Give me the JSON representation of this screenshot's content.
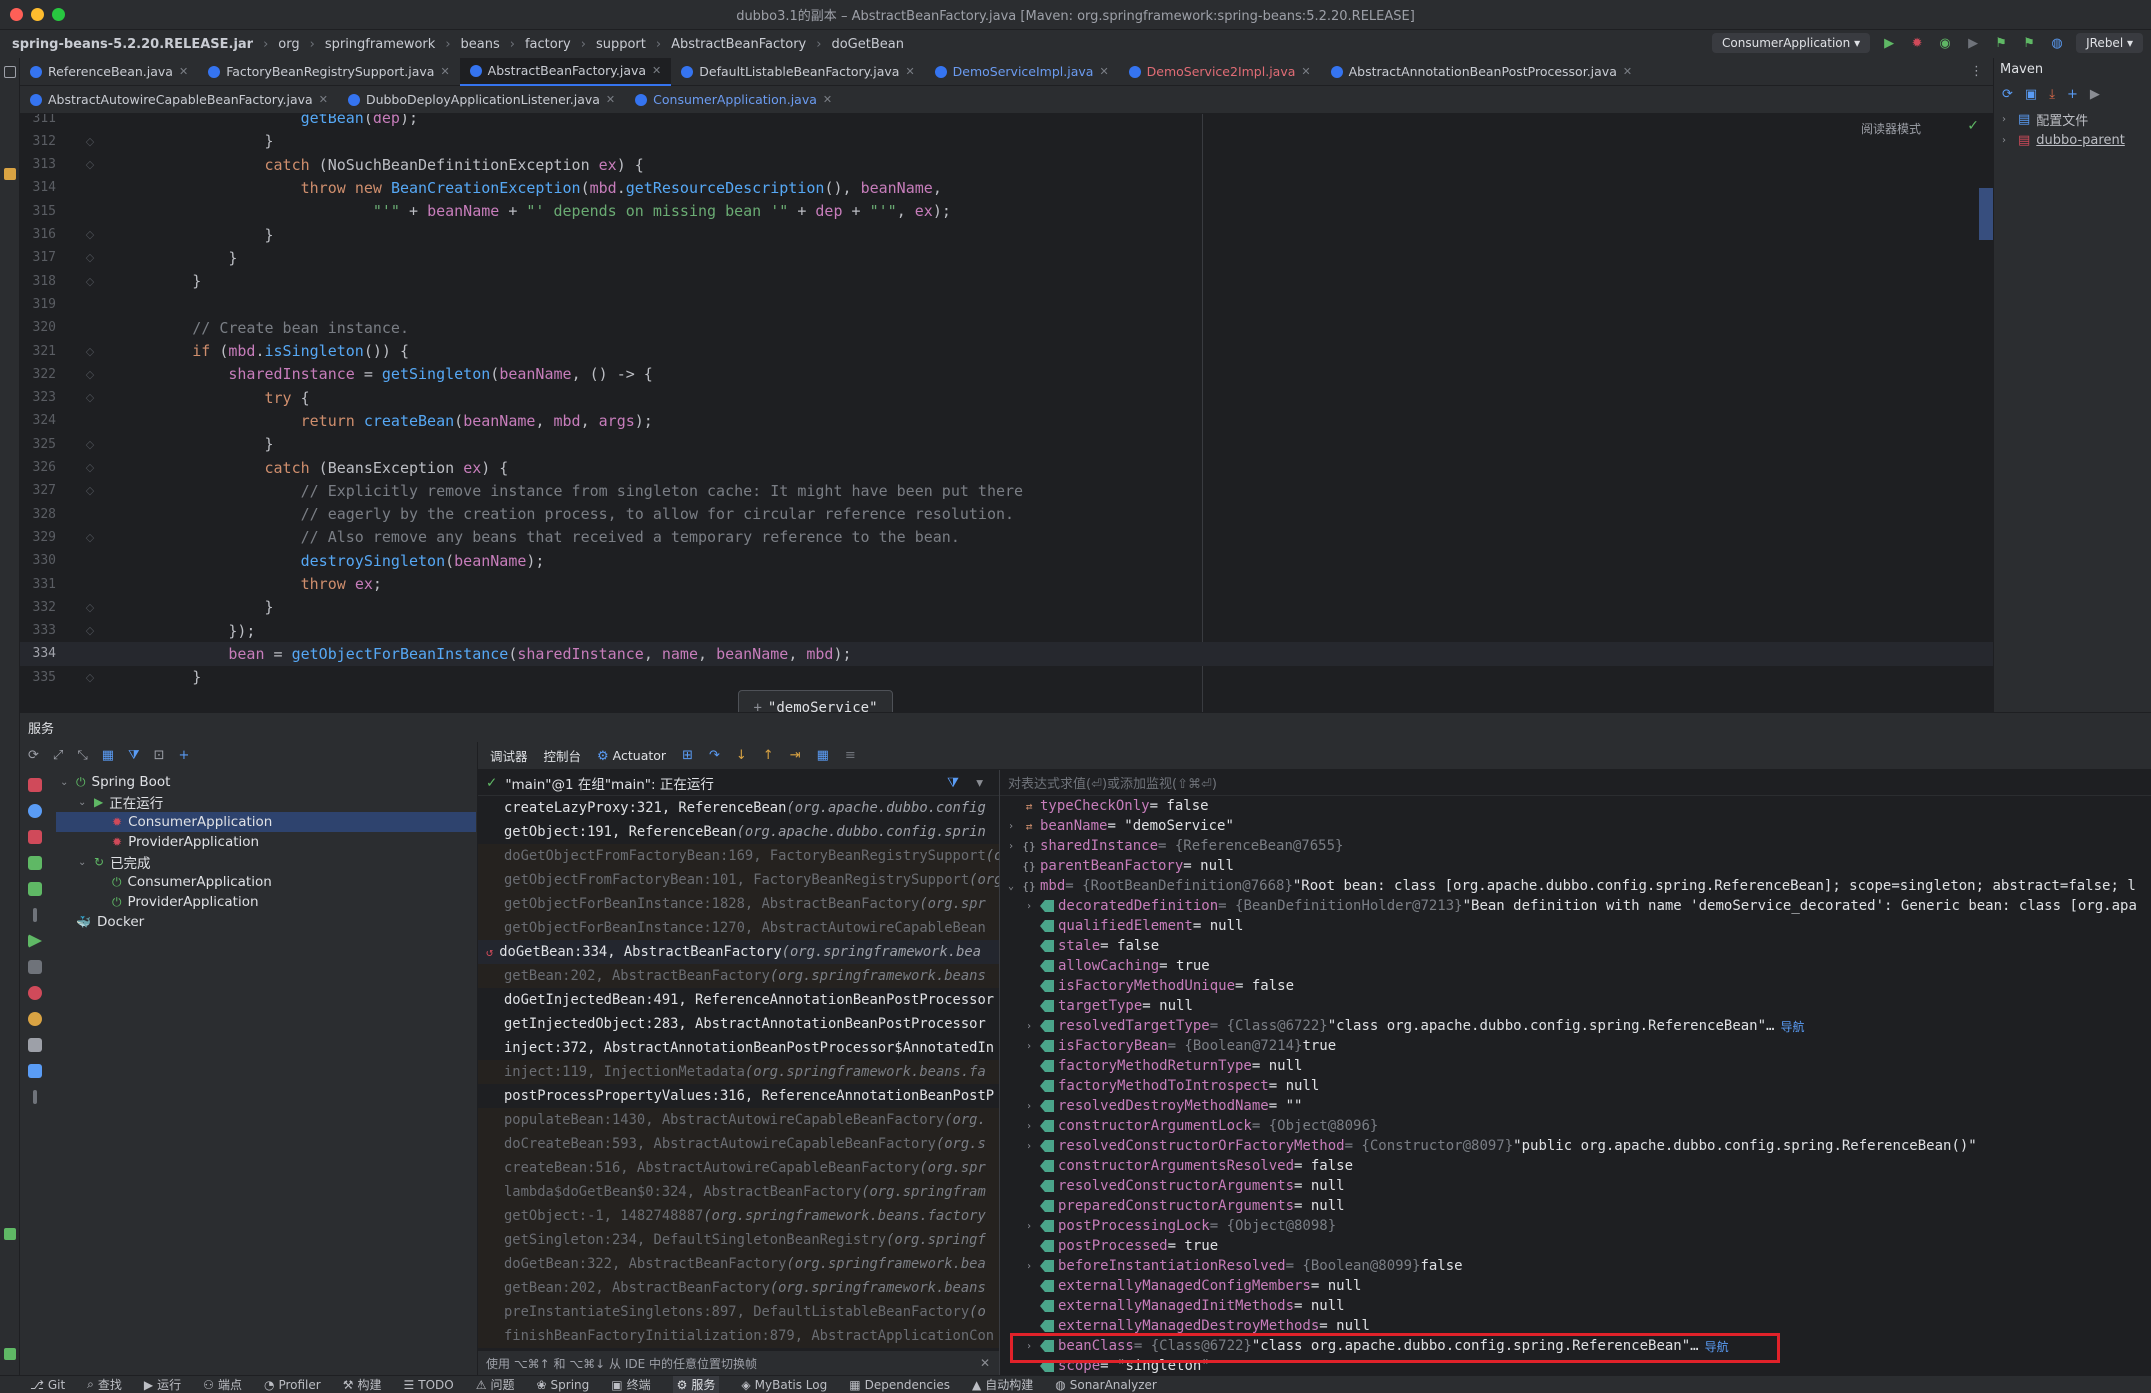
{
  "window": {
    "title": "dubbo3.1的副本 – AbstractBeanFactory.java [Maven: org.springframework:spring-beans:5.2.20.RELEASE]"
  },
  "breadcrumb": [
    "spring-beans-5.2.20.RELEASE.jar",
    "org",
    "springframework",
    "beans",
    "factory",
    "support",
    "AbstractBeanFactory",
    "doGetBean"
  ],
  "toolbar": {
    "run_config": "ConsumerApplication",
    "jrebel": "JRebel"
  },
  "tabs_row1": [
    {
      "label": "ReferenceBean.java",
      "style": "normal"
    },
    {
      "label": "FactoryBeanRegistrySupport.java",
      "style": "normal"
    },
    {
      "label": "AbstractBeanFactory.java",
      "style": "active"
    },
    {
      "label": "DefaultListableBeanFactory.java",
      "style": "normal"
    },
    {
      "label": "DemoServiceImpl.java",
      "style": "blue"
    },
    {
      "label": "DemoService2Impl.java",
      "style": "red"
    },
    {
      "label": "AbstractAnnotationBeanPostProcessor.java",
      "style": "normal"
    }
  ],
  "tabs_row2": [
    {
      "label": "AbstractAutowireCapableBeanFactory.java",
      "style": "normal"
    },
    {
      "label": "DubboDeployApplicationListener.java",
      "style": "normal"
    },
    {
      "label": "ConsumerApplication.java",
      "style": "blue"
    }
  ],
  "editor": {
    "reader_mode": "阅读器模式",
    "current_line": "334",
    "lines": [
      {
        "n": "311",
        "code": "                    getBean(dep);"
      },
      {
        "n": "312",
        "code": "                }"
      },
      {
        "n": "313",
        "code": "                catch (NoSuchBeanDefinitionException ex) {"
      },
      {
        "n": "314",
        "code": "                    throw new BeanCreationException(mbd.getResourceDescription(), beanName,"
      },
      {
        "n": "315",
        "code": "                            \"'\" + beanName + \"' depends on missing bean '\" + dep + \"'\", ex);"
      },
      {
        "n": "316",
        "code": "                }"
      },
      {
        "n": "317",
        "code": "            }"
      },
      {
        "n": "318",
        "code": "        }"
      },
      {
        "n": "319",
        "code": ""
      },
      {
        "n": "320",
        "code": "        // Create bean instance."
      },
      {
        "n": "321",
        "code": "        if (mbd.isSingleton()) {"
      },
      {
        "n": "322",
        "code": "            sharedInstance = getSingleton(beanName, () -> {"
      },
      {
        "n": "323",
        "code": "                try {"
      },
      {
        "n": "324",
        "code": "                    return createBean(beanName, mbd, args);"
      },
      {
        "n": "325",
        "code": "                }"
      },
      {
        "n": "326",
        "code": "                catch (BeansException ex) {"
      },
      {
        "n": "327",
        "code": "                    // Explicitly remove instance from singleton cache: It might have been put there"
      },
      {
        "n": "328",
        "code": "                    // eagerly by the creation process, to allow for circular reference resolution."
      },
      {
        "n": "329",
        "code": "                    // Also remove any beans that received a temporary reference to the bean."
      },
      {
        "n": "330",
        "code": "                    destroySingleton(beanName);"
      },
      {
        "n": "331",
        "code": "                    throw ex;"
      },
      {
        "n": "332",
        "code": "                }"
      },
      {
        "n": "333",
        "code": "            });"
      },
      {
        "n": "334",
        "code": "            bean = getObjectForBeanInstance(sharedInstance, name, beanName, mbd);"
      },
      {
        "n": "335",
        "code": "        }"
      }
    ],
    "tooltip": "\"demoService\""
  },
  "maven": {
    "title": "Maven",
    "items": [
      "配置文件",
      "dubbo-parent"
    ]
  },
  "services": {
    "title": "服务",
    "tree": [
      {
        "label": "Spring Boot",
        "level": 0,
        "arrow": "⌄"
      },
      {
        "label": "正在运行",
        "level": 1,
        "arrow": "⌄"
      },
      {
        "label": "ConsumerApplication",
        "level": 2,
        "arrow": "",
        "selected": true
      },
      {
        "label": "ProviderApplication",
        "level": 2,
        "arrow": ""
      },
      {
        "label": "已完成",
        "level": 1,
        "arrow": "⌄"
      },
      {
        "label": "ConsumerApplication",
        "level": 2,
        "arrow": ""
      },
      {
        "label": "ProviderApplication",
        "level": 2,
        "arrow": ""
      },
      {
        "label": "Docker",
        "level": 0,
        "arrow": ""
      }
    ]
  },
  "debugger": {
    "tabs": [
      "调试器",
      "控制台",
      "Actuator"
    ],
    "thread": "\"main\"@1 在组\"main\": 正在运行",
    "eval_placeholder": "对表达式求值(⏎)或添加监视(⇧⌘⏎)",
    "frames": [
      {
        "m": "createLazyProxy:321, ReferenceBean",
        "p": "(org.apache.dubbo.config",
        "kind": "usr"
      },
      {
        "m": "getObject:191, ReferenceBean",
        "p": "(org.apache.dubbo.config.sprin",
        "kind": "usr"
      },
      {
        "m": "doGetObjectFromFactoryBean:169, FactoryBeanRegistrySupport",
        "p": "(o",
        "kind": "lib"
      },
      {
        "m": "getObjectFromFactoryBean:101, FactoryBeanRegistrySupport",
        "p": "(org",
        "kind": "lib"
      },
      {
        "m": "getObjectForBeanInstance:1828, AbstractBeanFactory",
        "p": "(org.spr",
        "kind": "lib"
      },
      {
        "m": "getObjectForBeanInstance:1270, AbstractAutowireCapableBean",
        "p": "",
        "kind": "lib"
      },
      {
        "m": "doGetBean:334, AbstractBeanFactory",
        "p": "(org.springframework.bea",
        "kind": "cur"
      },
      {
        "m": "getBean:202, AbstractBeanFactory",
        "p": "(org.springframework.beans",
        "kind": "lib"
      },
      {
        "m": "doGetInjectedBean:491, ReferenceAnnotationBeanPostProcessor",
        "p": "",
        "kind": "usr"
      },
      {
        "m": "getInjectedObject:283, AbstractAnnotationBeanPostProcessor",
        "p": "",
        "kind": "usr"
      },
      {
        "m": "inject:372, AbstractAnnotationBeanPostProcessor$AnnotatedIn",
        "p": "",
        "kind": "usr"
      },
      {
        "m": "inject:119, InjectionMetadata",
        "p": "(org.springframework.beans.fa",
        "kind": "lib"
      },
      {
        "m": "postProcessPropertyValues:316, ReferenceAnnotationBeanPostP",
        "p": "",
        "kind": "usr"
      },
      {
        "m": "populateBean:1430, AbstractAutowireCapableBeanFactory",
        "p": "(org.",
        "kind": "lib"
      },
      {
        "m": "doCreateBean:593, AbstractAutowireCapableBeanFactory",
        "p": "(org.s",
        "kind": "lib"
      },
      {
        "m": "createBean:516, AbstractAutowireCapableBeanFactory",
        "p": "(org.spr",
        "kind": "lib"
      },
      {
        "m": "lambda$doGetBean$0:324, AbstractBeanFactory",
        "p": "(org.springfram",
        "kind": "lib"
      },
      {
        "m": "getObject:-1, 1482748887",
        "p": "(org.springframework.beans.factory",
        "kind": "lib"
      },
      {
        "m": "getSingleton:234, DefaultSingletonBeanRegistry",
        "p": "(org.springf",
        "kind": "lib"
      },
      {
        "m": "doGetBean:322, AbstractBeanFactory",
        "p": "(org.springframework.bea",
        "kind": "lib"
      },
      {
        "m": "getBean:202, AbstractBeanFactory",
        "p": "(org.springframework.beans",
        "kind": "lib"
      },
      {
        "m": "preInstantiateSingletons:897, DefaultListableBeanFactory",
        "p": "(o",
        "kind": "lib"
      },
      {
        "m": "finishBeanFactoryInitialization:879, AbstractApplicationCon",
        "p": "",
        "kind": "lib"
      }
    ],
    "frames_hint": "使用 ⌥⌘↑ 和 ⌥⌘↓ 从 IDE 中的任意位置切换帧",
    "variables": [
      {
        "d": 0,
        "exp": "",
        "ico": "param",
        "name": "typeCheckOnly",
        "type": "",
        "val": "= false"
      },
      {
        "d": 0,
        "exp": "›",
        "ico": "param",
        "name": "beanName",
        "type": "",
        "val": "= \"demoService\""
      },
      {
        "d": 0,
        "exp": "›",
        "ico": "brace",
        "name": "sharedInstance",
        "type": "= {ReferenceBean@7655}",
        "val": ""
      },
      {
        "d": 0,
        "exp": "",
        "ico": "brace",
        "name": "parentBeanFactory",
        "type": "",
        "val": "= null"
      },
      {
        "d": 0,
        "exp": "⌄",
        "ico": "brace",
        "name": "mbd",
        "type": "= {RootBeanDefinition@7668}",
        "val": "\"Root bean: class [org.apache.dubbo.config.spring.ReferenceBean]; scope=singleton; abstract=false; l"
      },
      {
        "d": 1,
        "exp": "›",
        "ico": "tag",
        "name": "decoratedDefinition",
        "type": "= {BeanDefinitionHolder@7213}",
        "val": "\"Bean definition with name 'demoService_decorated': Generic bean: class [org.apa"
      },
      {
        "d": 1,
        "exp": "",
        "ico": "tag",
        "name": "qualifiedElement",
        "type": "",
        "val": "= null"
      },
      {
        "d": 1,
        "exp": "",
        "ico": "tag",
        "name": "stale",
        "type": "",
        "val": "= false"
      },
      {
        "d": 1,
        "exp": "",
        "ico": "tag",
        "name": "allowCaching",
        "type": "",
        "val": "= true"
      },
      {
        "d": 1,
        "exp": "",
        "ico": "tag",
        "name": "isFactoryMethodUnique",
        "type": "",
        "val": "= false"
      },
      {
        "d": 1,
        "exp": "",
        "ico": "tag",
        "name": "targetType",
        "type": "",
        "val": "= null"
      },
      {
        "d": 1,
        "exp": "›",
        "ico": "tag",
        "name": "resolvedTargetType",
        "type": "= {Class@6722}",
        "val": "\"class org.apache.dubbo.config.spring.ReferenceBean\"…",
        "nav": "导航"
      },
      {
        "d": 1,
        "exp": "›",
        "ico": "tag",
        "name": "isFactoryBean",
        "type": "= {Boolean@7214}",
        "val": "true"
      },
      {
        "d": 1,
        "exp": "",
        "ico": "tag",
        "name": "factoryMethodReturnType",
        "type": "",
        "val": "= null"
      },
      {
        "d": 1,
        "exp": "",
        "ico": "tag",
        "name": "factoryMethodToIntrospect",
        "type": "",
        "val": "= null"
      },
      {
        "d": 1,
        "exp": "›",
        "ico": "tag",
        "name": "resolvedDestroyMethodName",
        "type": "",
        "val": "= \"\""
      },
      {
        "d": 1,
        "exp": "›",
        "ico": "tag",
        "name": "constructorArgumentLock",
        "type": "= {Object@8096}",
        "val": ""
      },
      {
        "d": 1,
        "exp": "›",
        "ico": "tag",
        "name": "resolvedConstructorOrFactoryMethod",
        "type": "= {Constructor@8097}",
        "val": "\"public org.apache.dubbo.config.spring.ReferenceBean()\""
      },
      {
        "d": 1,
        "exp": "",
        "ico": "tag",
        "name": "constructorArgumentsResolved",
        "type": "",
        "val": "= false"
      },
      {
        "d": 1,
        "exp": "",
        "ico": "tag",
        "name": "resolvedConstructorArguments",
        "type": "",
        "val": "= null"
      },
      {
        "d": 1,
        "exp": "",
        "ico": "tag",
        "name": "preparedConstructorArguments",
        "type": "",
        "val": "= null"
      },
      {
        "d": 1,
        "exp": "›",
        "ico": "tag",
        "name": "postProcessingLock",
        "type": "= {Object@8098}",
        "val": ""
      },
      {
        "d": 1,
        "exp": "",
        "ico": "tag",
        "name": "postProcessed",
        "type": "",
        "val": "= true"
      },
      {
        "d": 1,
        "exp": "›",
        "ico": "tag",
        "name": "beforeInstantiationResolved",
        "type": "= {Boolean@8099}",
        "val": "false"
      },
      {
        "d": 1,
        "exp": "",
        "ico": "tag",
        "name": "externallyManagedConfigMembers",
        "type": "",
        "val": "= null"
      },
      {
        "d": 1,
        "exp": "",
        "ico": "tag",
        "name": "externallyManagedInitMethods",
        "type": "",
        "val": "= null"
      },
      {
        "d": 1,
        "exp": "",
        "ico": "tag",
        "name": "externallyManagedDestroyMethods",
        "type": "",
        "val": "= null"
      },
      {
        "d": 1,
        "exp": "›",
        "ico": "tag",
        "name": "beanClass",
        "type": "= {Class@6722}",
        "val": "\"class org.apache.dubbo.config.spring.ReferenceBean\"…",
        "nav": "导航"
      },
      {
        "d": 1,
        "exp": "",
        "ico": "tag",
        "name": "scope",
        "type": "",
        "val": "= \"singleton\""
      }
    ]
  },
  "statusbar": [
    "Git",
    "查找",
    "运行",
    "端点",
    "Profiler",
    "构建",
    "TODO",
    "问题",
    "Spring",
    "终端",
    "服务",
    "MyBatis Log",
    "Dependencies",
    "自动构建",
    "SonarAnalyzer"
  ]
}
